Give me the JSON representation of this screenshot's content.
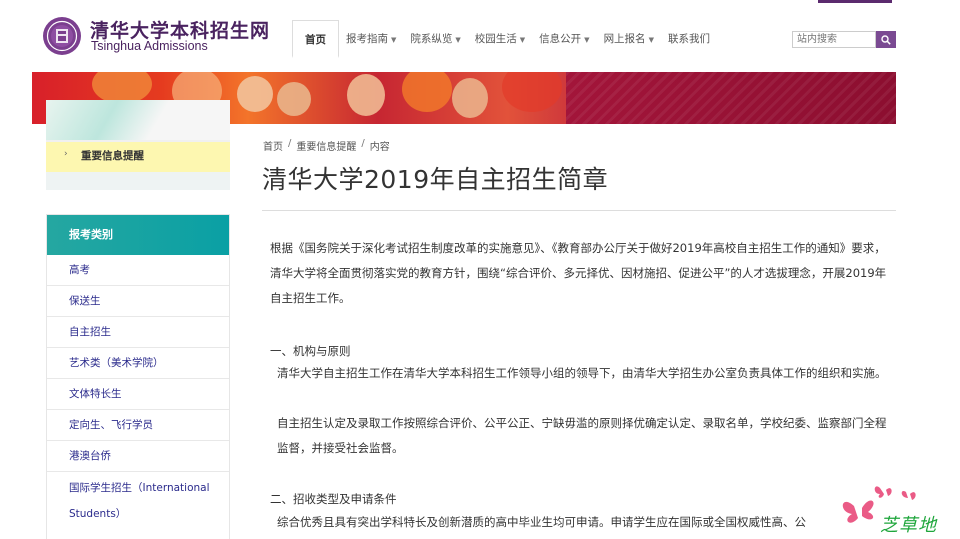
{
  "header": {
    "title": "清华大学本科招生网",
    "subtitle": "Tsinghua Admissions",
    "nav": [
      {
        "label": "首页",
        "caret": false,
        "active": true
      },
      {
        "label": "报考指南",
        "caret": true
      },
      {
        "label": "院系纵览",
        "caret": true
      },
      {
        "label": "校园生活",
        "caret": true
      },
      {
        "label": "信息公开",
        "caret": true
      },
      {
        "label": "网上报名",
        "caret": true
      },
      {
        "label": "联系我们",
        "caret": false
      }
    ],
    "search": {
      "placeholder": "站内搜索"
    },
    "colors": {
      "brand": "#4a2360",
      "accent": "#7a4a92"
    }
  },
  "sidebar": {
    "highlight_label": "重要信息提醒",
    "category_title": "报考类别",
    "categories": [
      "高考",
      "保送生",
      "自主招生",
      "艺术类（美术学院）",
      "文体特长生",
      "定向生、飞行学员",
      "港澳台侨",
      "国际学生招生（International Students）"
    ],
    "colors": {
      "category_head": "#0aa0a4",
      "highlight_bg": "#fdf7b0"
    }
  },
  "main": {
    "breadcrumb": [
      "首页",
      "重要信息提醒",
      "内容"
    ],
    "title": "清华大学2019年自主招生简章",
    "intro": "根据《国务院关于深化考试招生制度改革的实施意见》、《教育部办公厅关于做好2019年高校自主招生工作的通知》要求，清华大学将全面贯彻落实党的教育方针，围绕“综合评价、多元择优、因材施招、促进公平”的人才选拔理念，开展2019年自主招生工作。",
    "section1_heading": "一、机构与原则",
    "section1_p1": "清华大学自主招生工作在清华大学本科招生工作领导小组的领导下，由清华大学招生办公室负责具体工作的组织和实施。",
    "section1_p2": "自主招生认定及录取工作按照综合评价、公平公正、宁缺毋滥的原则择优确定认定、录取名单，学校纪委、监察部门全程监督，并接受社会监督。",
    "section2_heading": "二、招收类型及申请条件",
    "section2_p1": "综合优秀且具有突出学科特长及创新潜质的高中毕业生均可申请。申请学生应在国际或全国权威性高、公"
  },
  "watermark": {
    "text": "芝草地"
  }
}
